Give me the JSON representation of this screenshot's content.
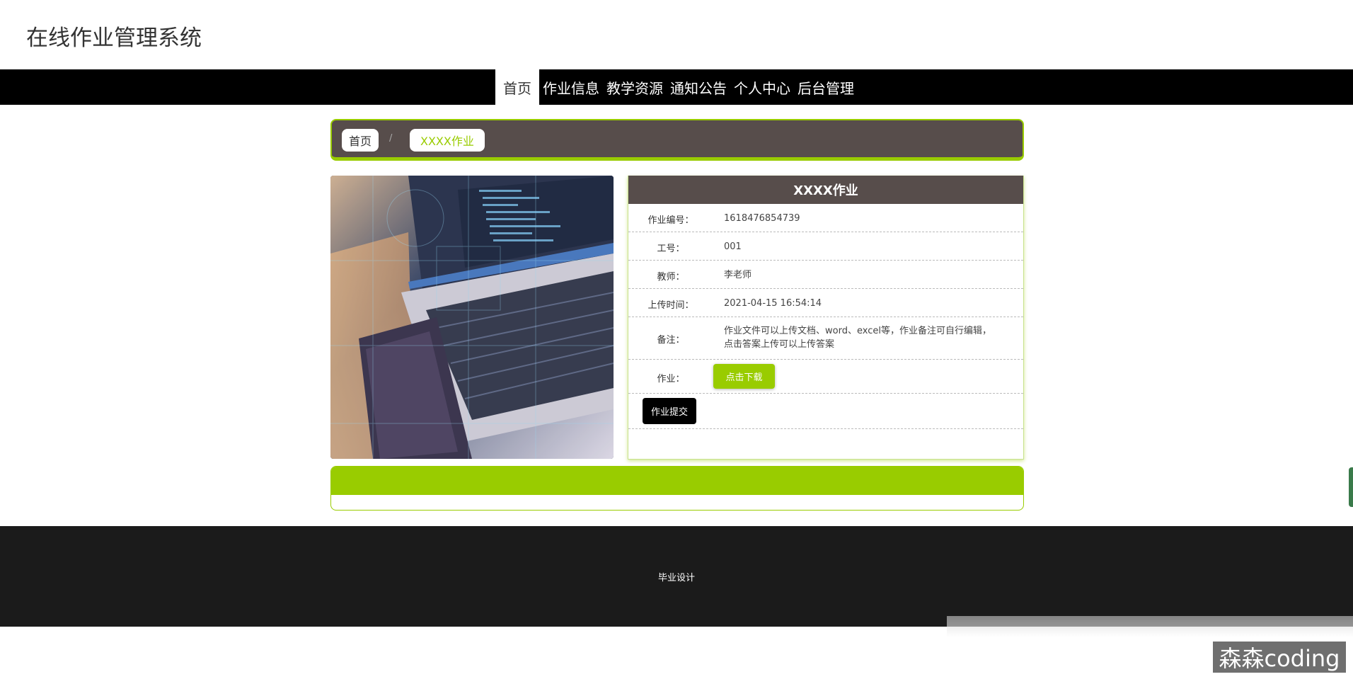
{
  "site": {
    "title": "在线作业管理系统"
  },
  "nav": {
    "items": [
      {
        "label": "首页",
        "active": true
      },
      {
        "label": "作业信息",
        "active": false
      },
      {
        "label": "教学资源",
        "active": false
      },
      {
        "label": "通知公告",
        "active": false
      },
      {
        "label": "个人中心",
        "active": false
      },
      {
        "label": "后台管理",
        "active": false
      }
    ]
  },
  "breadcrumb": {
    "home": "首页",
    "separator": "/",
    "current": "XXXX作业"
  },
  "detail": {
    "title": "XXXX作业",
    "fields": [
      {
        "label": "作业编号：",
        "value": "1618476854739"
      },
      {
        "label": "工号：",
        "value": "001"
      },
      {
        "label": "教师：",
        "value": "李老师"
      },
      {
        "label": "上传时间：",
        "value": "2021-04-15 16:54:14"
      },
      {
        "label": "备注：",
        "value": "作业文件可以上传文档、word、excel等，作业备注可自行编辑，点击答案上传可以上传答案"
      }
    ],
    "file_label": "作业：",
    "download_button": "点击下载",
    "submit_button": "作业提交"
  },
  "footer": {
    "text": "毕业设计"
  },
  "watermark": "森森coding",
  "colors": {
    "accent": "#99cc00",
    "header_bg": "#574d4b",
    "nav_bg": "#000000",
    "footer_bg": "#1b1b1b"
  }
}
